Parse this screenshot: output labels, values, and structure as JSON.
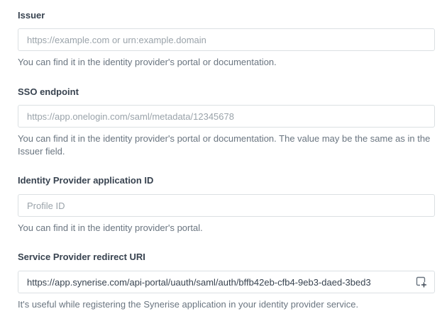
{
  "issuer": {
    "label": "Issuer",
    "placeholder": "https://example.com or urn:example.domain",
    "help": "You can find it in the identity provider's portal or documentation."
  },
  "sso_endpoint": {
    "label": "SSO endpoint",
    "placeholder": "https://app.onelogin.com/saml/metadata/12345678",
    "help": "You can find it in the identity provider's portal or documentation. The value may be the same as in the Issuer field."
  },
  "idp_app_id": {
    "label": "Identity Provider application ID",
    "placeholder": "Profile ID",
    "help": "You can find it in the identity provider's portal."
  },
  "sp_redirect_uri": {
    "label": "Service Provider redirect URI",
    "value": "https://app.synerise.com/api-portal/uauth/saml/auth/bffb42eb-cfb4-9eb3-daed-3bed3",
    "help": "It's useful while registering the Synerise application in your identity provider service.",
    "copy_icon": "copy-icon"
  },
  "colors": {
    "label": "#384350",
    "help": "#6a7580",
    "placeholder": "#9aa3aa",
    "border": "#dbe0e3"
  }
}
